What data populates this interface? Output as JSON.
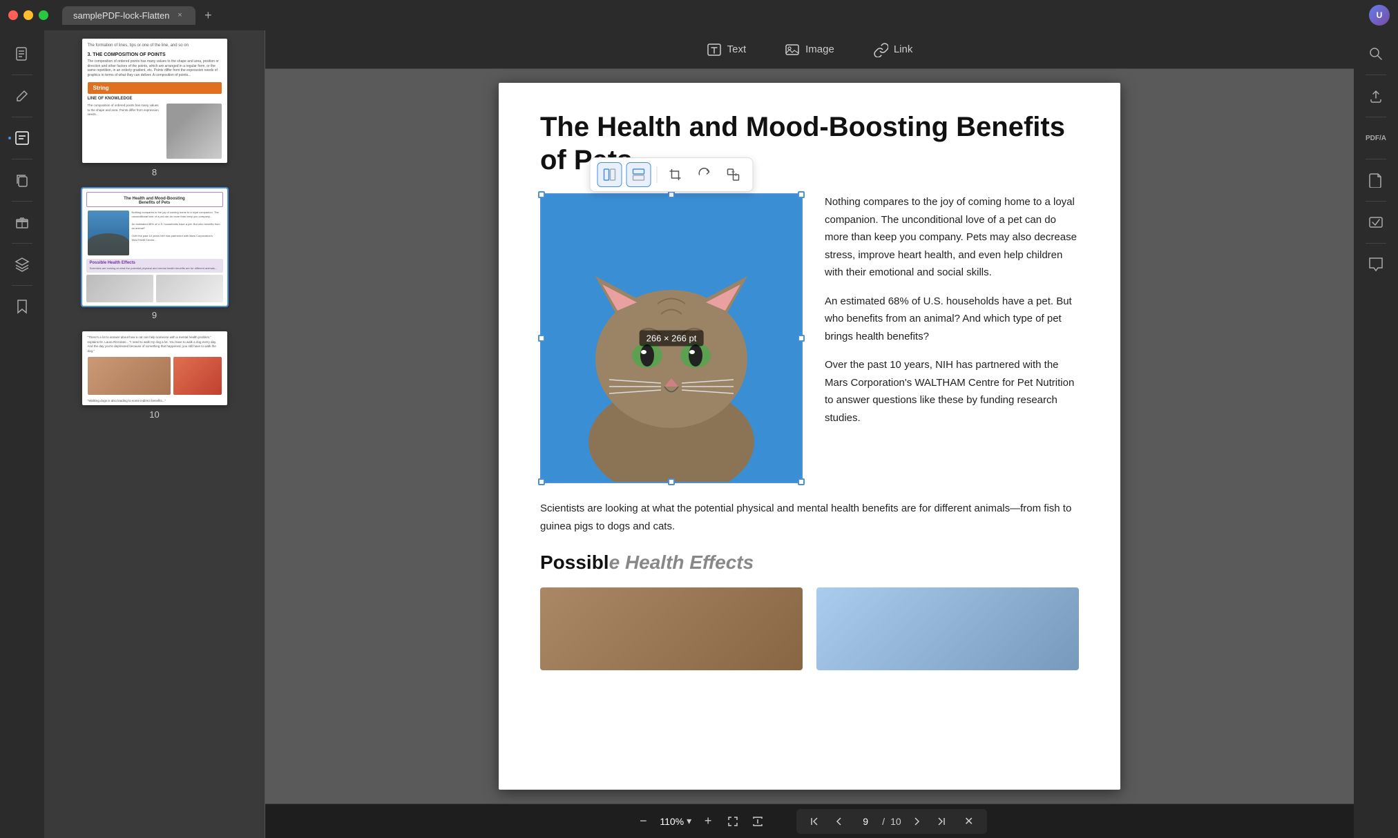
{
  "titlebar": {
    "tab_title": "samplePDF-lock-Flatten",
    "close_label": "×",
    "add_label": "+"
  },
  "toolbar_top": {
    "text_label": "Text",
    "image_label": "Image",
    "link_label": "Link"
  },
  "sidebar_left": {
    "icons": [
      {
        "name": "notes-icon",
        "glyph": "🗒",
        "active": false
      },
      {
        "name": "edit-icon",
        "glyph": "✏️",
        "active": false
      },
      {
        "name": "comment-icon",
        "glyph": "💬",
        "active": true
      },
      {
        "name": "copy-icon",
        "glyph": "📋",
        "active": false
      },
      {
        "name": "layers-icon",
        "glyph": "⬡",
        "active": false
      },
      {
        "name": "bookmark-icon",
        "glyph": "🔖",
        "active": false
      }
    ]
  },
  "thumbnails": [
    {
      "page": "8",
      "selected": false
    },
    {
      "page": "9",
      "selected": true
    },
    {
      "page": "10",
      "selected": false
    }
  ],
  "page": {
    "title": "The Health and Mood-Boosting Benefits of Pets",
    "image_size": "266 × 266 pt",
    "para1": "Nothing compares to the joy of coming home to a loyal companion. The unconditional love of a pet can do more than keep you company. Pets may also decrease stress, improve heart health,  and  even  help children  with  their emotional and social skills.",
    "para2": "An estimated 68% of U.S. households have a pet. But who benefits from an animal? And which type of pet brings health benefits?",
    "para3": "Over  the  past  10  years,  NIH  has partnered with the Mars Corporation's WALTHAM Centre for  Pet  Nutrition  to answer  questions  like these by funding research studies.",
    "footer": "Scientists are looking at what the potential physical and mental health benefits are for different animals—from fish to guinea pigs to dogs and cats.",
    "possible_heading": "Possibl"
  },
  "zoom": {
    "value": "110%",
    "decrease_label": "−",
    "increase_label": "+",
    "zoom_in_label": "↑",
    "zoom_out_label": "↓"
  },
  "page_nav": {
    "current": "9",
    "slash": "/",
    "total": "10",
    "first_label": "⇧",
    "prev_label": "∧",
    "next_label": "∨",
    "last_label": "⇩"
  },
  "img_toolbar": {
    "btn1": "⊡",
    "btn2": "⊟",
    "btn3": "⊞",
    "btn4": "↗",
    "btn5": "⤢"
  },
  "sidebar_right": {
    "icons": [
      {
        "name": "search-right-icon",
        "glyph": "🔍"
      },
      {
        "name": "upload-icon",
        "glyph": "↑"
      },
      {
        "name": "pdf-icon",
        "glyph": "PDF"
      },
      {
        "name": "file-icon",
        "glyph": "📄"
      },
      {
        "name": "check-icon",
        "glyph": "✓"
      },
      {
        "name": "comment-right-icon",
        "glyph": "💬"
      }
    ]
  }
}
